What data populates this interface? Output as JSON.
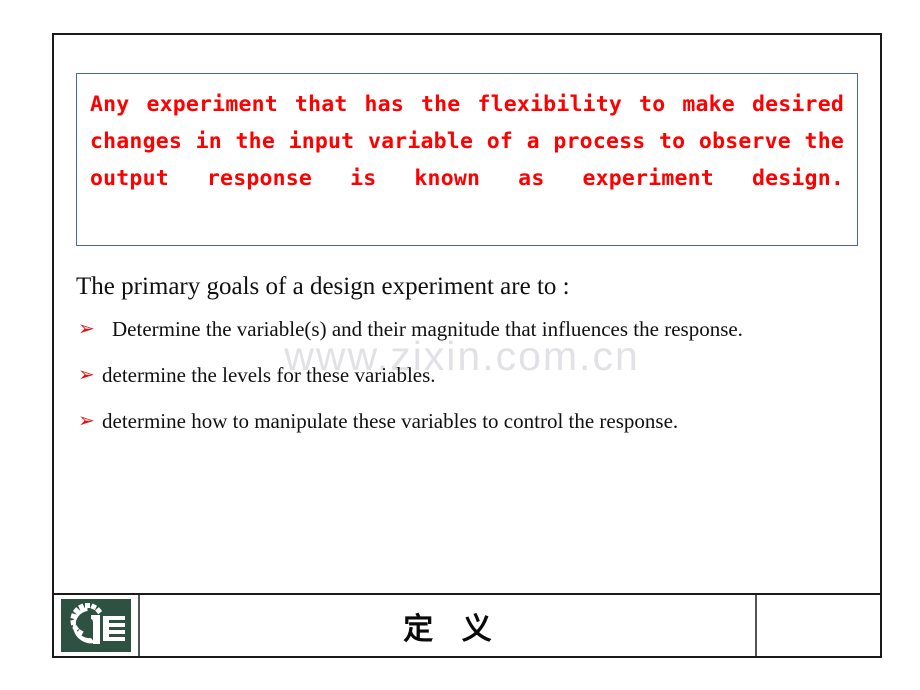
{
  "slide": {
    "definition_box": {
      "text": "Any experiment that has the flexibility to make desired changes in the input variable of a process to observe the output response is known as experiment design.",
      "text_color": "#ff0000",
      "border_color": "#4763bd"
    },
    "watermark": {
      "text": "www.zixin.com.cn",
      "color": "#e2e2e6"
    },
    "lead_text": "The primary goals of a design experiment are to :",
    "bullets": [
      {
        "marker": "➢",
        "text": "Determine the variable(s) and their magnitude that influences the response."
      },
      {
        "marker": "➢",
        "text": "determine the levels for these variables."
      },
      {
        "marker": "➢",
        "text": "determine how to manipulate these variables to control the response."
      }
    ],
    "bullet_color": "#e01010",
    "footer": {
      "logo_name": "mechanical-engineering-gear-logo",
      "logo_color": "#2e5242",
      "title": "定 义",
      "right_cell": ""
    }
  }
}
